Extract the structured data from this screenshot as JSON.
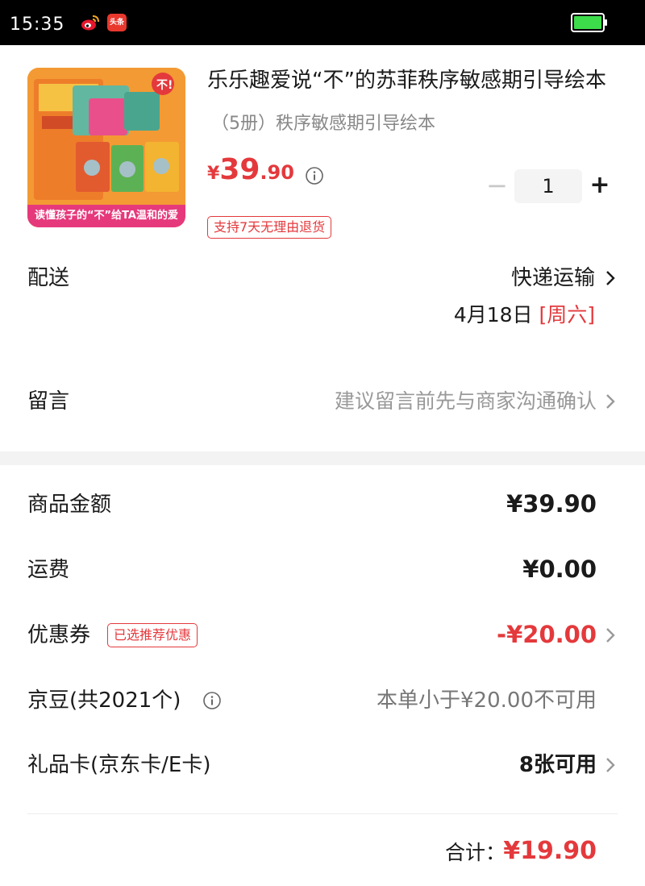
{
  "status_bar": {
    "time": "15:35",
    "app_icons": [
      "weibo-icon",
      "toutiao-icon"
    ],
    "toutiao_label": "头条",
    "battery_icon": "battery-icon",
    "battery_color": "#3ddc4b"
  },
  "product": {
    "title": "乐乐趣爱说“不”的苏菲秩序敏感期引导绘本",
    "spec": "（5册）秩序敏感期引导绘本",
    "price_currency": "¥",
    "price_integer": "39",
    "price_decimal": ".90",
    "price_info_icon": "info-icon",
    "quantity_minus": "−",
    "quantity": "1",
    "quantity_plus": "+",
    "return_tag": "支持7天无理由退货",
    "image_banner": "读懂孩子的“不”给TA温和的爱"
  },
  "delivery": {
    "label": "配送",
    "method": "快递运输",
    "date": "4月18日",
    "weekday": "[周六]"
  },
  "remark": {
    "label": "留言",
    "placeholder": "建议留言前先与商家沟通确认"
  },
  "summary": {
    "goods_label": "商品金额",
    "goods_value": "¥39.90",
    "shipping_label": "运费",
    "shipping_value": "¥0.00",
    "coupon_label": "优惠券",
    "coupon_tag": "已选推荐优惠",
    "coupon_value": "-¥20.00",
    "jdbean_label": "京豆(共2021个)",
    "jdbean_value": "本单小于¥20.00不可用",
    "giftcard_label": "礼品卡(京东卡/E卡)",
    "giftcard_value": "8张可用",
    "total_label": "合计：",
    "total_value": "¥19.90"
  },
  "colors": {
    "accent_red": "#e4393c",
    "gray_text": "#888888",
    "section_bg": "#f3f3f3"
  }
}
